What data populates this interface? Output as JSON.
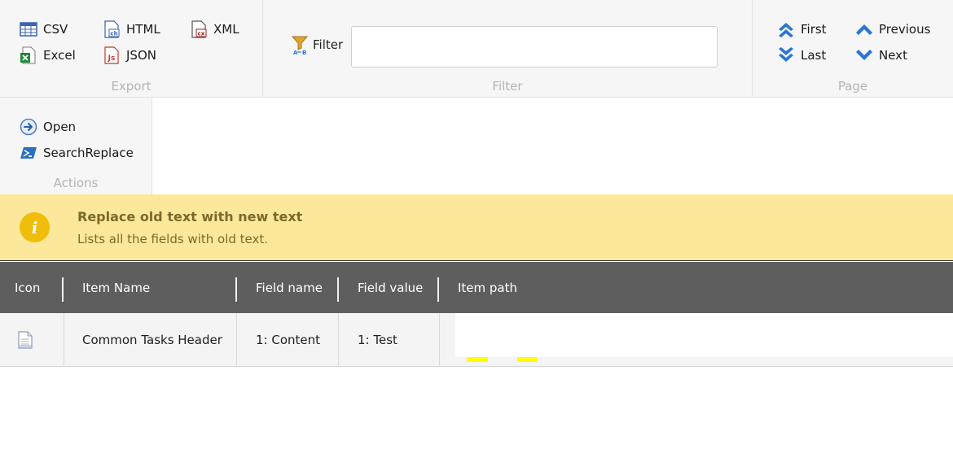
{
  "ribbon": {
    "export": {
      "caption": "Export",
      "csv": "CSV",
      "excel": "Excel",
      "html": "HTML",
      "json": "JSON",
      "xml": "XML"
    },
    "filter": {
      "caption": "Filter",
      "label": "Filter",
      "value": ""
    },
    "page": {
      "caption": "Page",
      "first": "First",
      "last": "Last",
      "previous": "Previous",
      "next": "Next"
    },
    "actions": {
      "caption": "Actions",
      "open": "Open",
      "search_replace": "SearchReplace"
    }
  },
  "info": {
    "title": "Replace old text with new text",
    "subtitle": "Lists all the fields with old text."
  },
  "grid": {
    "columns": [
      "Icon",
      "Item Name",
      "Field name",
      "Field value",
      "Item path"
    ],
    "rows": [
      {
        "icon": "document-icon",
        "item_name": "Common Tasks Header",
        "field_name": "1: Content",
        "field_value": "1: Test",
        "item_path": ""
      }
    ]
  },
  "colors": {
    "info_bar": "#fbe89b",
    "header": "#5e5e5e",
    "accent_blue": "#2a74d6",
    "info_icon": "#f0bd0a"
  }
}
